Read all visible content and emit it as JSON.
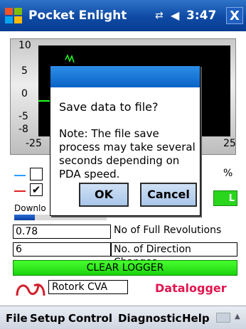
{
  "titlebar": {
    "app_title": "Pocket Enlight",
    "time": "3:47",
    "close_label": "X"
  },
  "chart": {
    "y_ticks": [
      "10",
      "5",
      "0",
      "-5",
      "-8"
    ],
    "x_ticks": [
      "-25",
      "25"
    ]
  },
  "controls": {
    "percent": "%",
    "download_label": "Downlo",
    "progress_fraction": 0.22,
    "right_button_label": "L"
  },
  "fields": [
    {
      "value": "0.78",
      "label": "No of Full Revolutions"
    },
    {
      "value": "6",
      "label": "No. of Direction Changes"
    }
  ],
  "clear_logger": "CLEAR LOGGER",
  "model": "Rotork CVA",
  "mode_title": "Datalogger",
  "menu": [
    "File",
    "Setup",
    "Control",
    "Diagnostic",
    "Help"
  ],
  "dialog": {
    "title": "Save data to file?",
    "note": "Note: The file save process may take several seconds depending on PDA speed.",
    "ok": "OK",
    "cancel": "Cancel"
  },
  "colors": {
    "accent_green": "#1bd30c",
    "datalogger_red": "#e0164f",
    "titlebar_blue": "#0f4aa4"
  }
}
